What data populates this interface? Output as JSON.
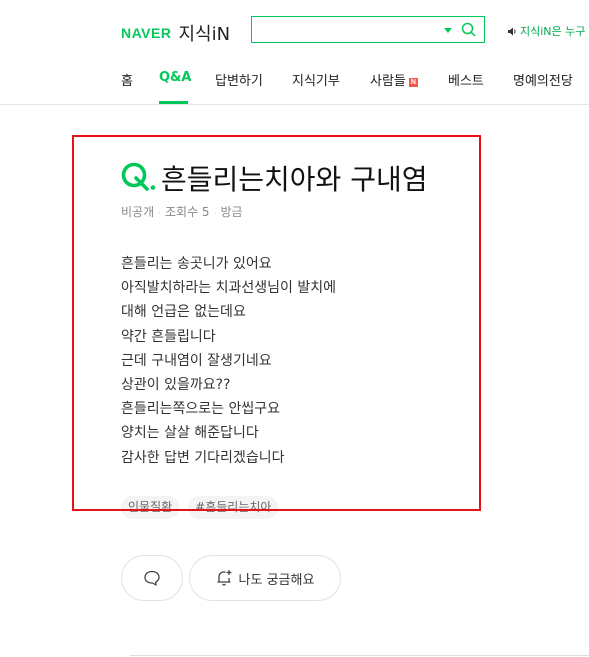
{
  "header": {
    "logo_naver": "NAVER",
    "logo_service": "지식iN",
    "search_value": "",
    "notice": "지식iN은 누구"
  },
  "nav": {
    "items": [
      "홈",
      "Q&A",
      "답변하기",
      "지식기부",
      "사람들",
      "베스트",
      "명예의전당"
    ],
    "active_index": 1,
    "new_badge": "N"
  },
  "question": {
    "title": "흔들리는치아와 구내염",
    "author": "비공개",
    "views": "조회수 5",
    "time": "방금",
    "body": [
      "흔들리는 송곳니가 있어요",
      "아직발치하라는 치과선생님이 발치에",
      "대해 언급은 없는데요",
      "약간 흔들립니다",
      "근데 구내염이 잘생기네요",
      "상관이 있을까요??",
      "흔들리는쪽으로는 안씹구요",
      "양치는 살살 해준답니다",
      "감사한 답변 기다리겠습니다"
    ],
    "tags": [
      "인물질환",
      "#흔들리는치아"
    ]
  },
  "actions": {
    "curious_label": "나도 궁금해요"
  },
  "colors": {
    "brand": "#03c75a",
    "highlight_box": "#e8111b",
    "new_badge": "#f25b4b"
  },
  "icons": [
    "search-icon",
    "speaker-icon",
    "comment-icon",
    "bell-plus-icon",
    "dropdown-caret-icon"
  ]
}
